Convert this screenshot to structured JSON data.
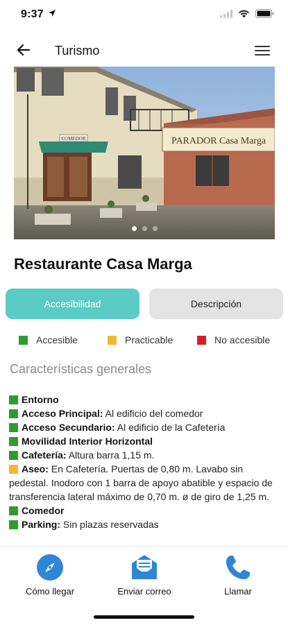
{
  "status_bar": {
    "time": "9:37"
  },
  "app_bar": {
    "title": "Turismo"
  },
  "hero": {
    "sign_text": "PARADOR Casa Marga",
    "door_sign": "COMEDOR",
    "slides": 3,
    "active_slide": 1
  },
  "place": {
    "name": "Restaurante Casa Marga"
  },
  "tabs": [
    {
      "label": "Accesibilidad",
      "active": true
    },
    {
      "label": "Descripción",
      "active": false
    }
  ],
  "legend": [
    {
      "label": "Accesible",
      "color": "#2e9d2e"
    },
    {
      "label": "Practicable",
      "color": "#f5b731"
    },
    {
      "label": "No accesible",
      "color": "#d41f2b"
    }
  ],
  "section": {
    "title": "Características generales"
  },
  "features": [
    {
      "label": "Entorno",
      "value": "",
      "status": "accesible"
    },
    {
      "label": "Acceso Principal:",
      "value": "Al edificio del comedor",
      "status": "accesible"
    },
    {
      "label": "Acceso Secundario:",
      "value": "Al edificio de la Cafetería",
      "status": "accesible"
    },
    {
      "label": "Movilidad Interior Horizontal",
      "value": "",
      "status": "accesible"
    },
    {
      "label": "Cafetería:",
      "value": "Altura barra 1,15 m.",
      "status": "accesible"
    },
    {
      "label": "Aseo:",
      "value": "En Cafetería. Puertas de 0,80 m. Lavabo sin pedestal. Inodoro con 1 barra de apoyo abatible y espacio de transferencia lateral máximo de 0,70 m. ø de giro de 1,25 m.",
      "status": "practicable"
    },
    {
      "label": "Comedor",
      "value": "",
      "status": "accesible"
    },
    {
      "label": "Parking:",
      "value": "Sin plazas reservadas",
      "status": "accesible"
    }
  ],
  "status_colors": {
    "accesible": "#2e9d2e",
    "practicable": "#f5b731",
    "no_accesible": "#d41f2b"
  },
  "actions": [
    {
      "label": "Cómo llegar",
      "icon": "compass-icon"
    },
    {
      "label": "Enviar correo",
      "icon": "mail-icon"
    },
    {
      "label": "Llamar",
      "icon": "phone-icon"
    }
  ],
  "accent_color": "#2f86d6"
}
